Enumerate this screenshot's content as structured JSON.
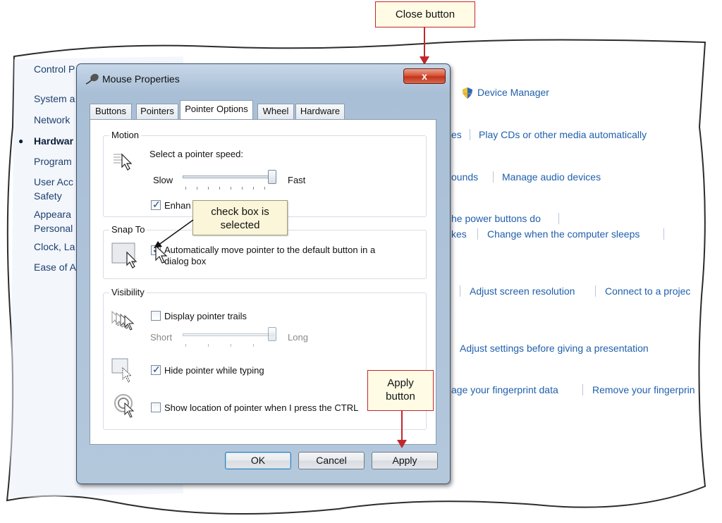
{
  "callouts": {
    "close_button": "Close button",
    "check_box_selected": [
      "check box is",
      "selected"
    ],
    "apply_button": [
      "Apply",
      "button"
    ]
  },
  "control_panel": {
    "breadcrumb": "Control P",
    "nav": [
      "System a",
      "Network",
      "Hardwar",
      "Program",
      "User Acc",
      "Safety",
      "Appeara",
      "Personal",
      "Clock, La",
      "Ease of A"
    ],
    "links": {
      "device_manager": "Device Manager",
      "autoplay_partial": "es",
      "play_cds": "Play CDs or other media automatically",
      "sounds_partial": "ounds",
      "manage_audio": "Manage audio devices",
      "power_buttons": "he power buttons do",
      "sleep_partial": "kes",
      "change_sleep": "Change when the computer sleeps",
      "adjust_resolution": "Adjust screen resolution",
      "connect_projector": "Connect to a projec",
      "adjust_presentation": "Adjust settings before giving a presentation",
      "fingerprint_manage": "age your fingerprint data",
      "fingerprint_remove": "Remove your fingerprin"
    }
  },
  "dialog": {
    "title": "Mouse Properties",
    "close_symbol": "x",
    "tabs": [
      "Buttons",
      "Pointers",
      "Pointer Options",
      "Wheel",
      "Hardware"
    ],
    "active_tab": "Pointer Options",
    "motion": {
      "label": "Motion",
      "speed_label": "Select a pointer speed:",
      "slow": "Slow",
      "fast": "Fast",
      "enhance_precision": "Enhan",
      "enhance_checked": true
    },
    "snap_to": {
      "label": "Snap To",
      "line1": "Automatically move pointer to the default button in a",
      "line2": "dialog box",
      "checked": true
    },
    "visibility": {
      "label": "Visibility",
      "trails": "Display pointer trails",
      "trails_checked": false,
      "short": "Short",
      "long": "Long",
      "hide_typing": "Hide pointer while typing",
      "hide_checked": true,
      "show_ctrl": "Show location of pointer when I press the CTRL",
      "show_ctrl_checked": false
    },
    "buttons": {
      "ok": "OK",
      "cancel": "Cancel",
      "apply": "Apply"
    }
  },
  "colors": {
    "callout_border": "#c1272d",
    "link": "#1f5fab",
    "checkmark": "#1d3f8a"
  }
}
